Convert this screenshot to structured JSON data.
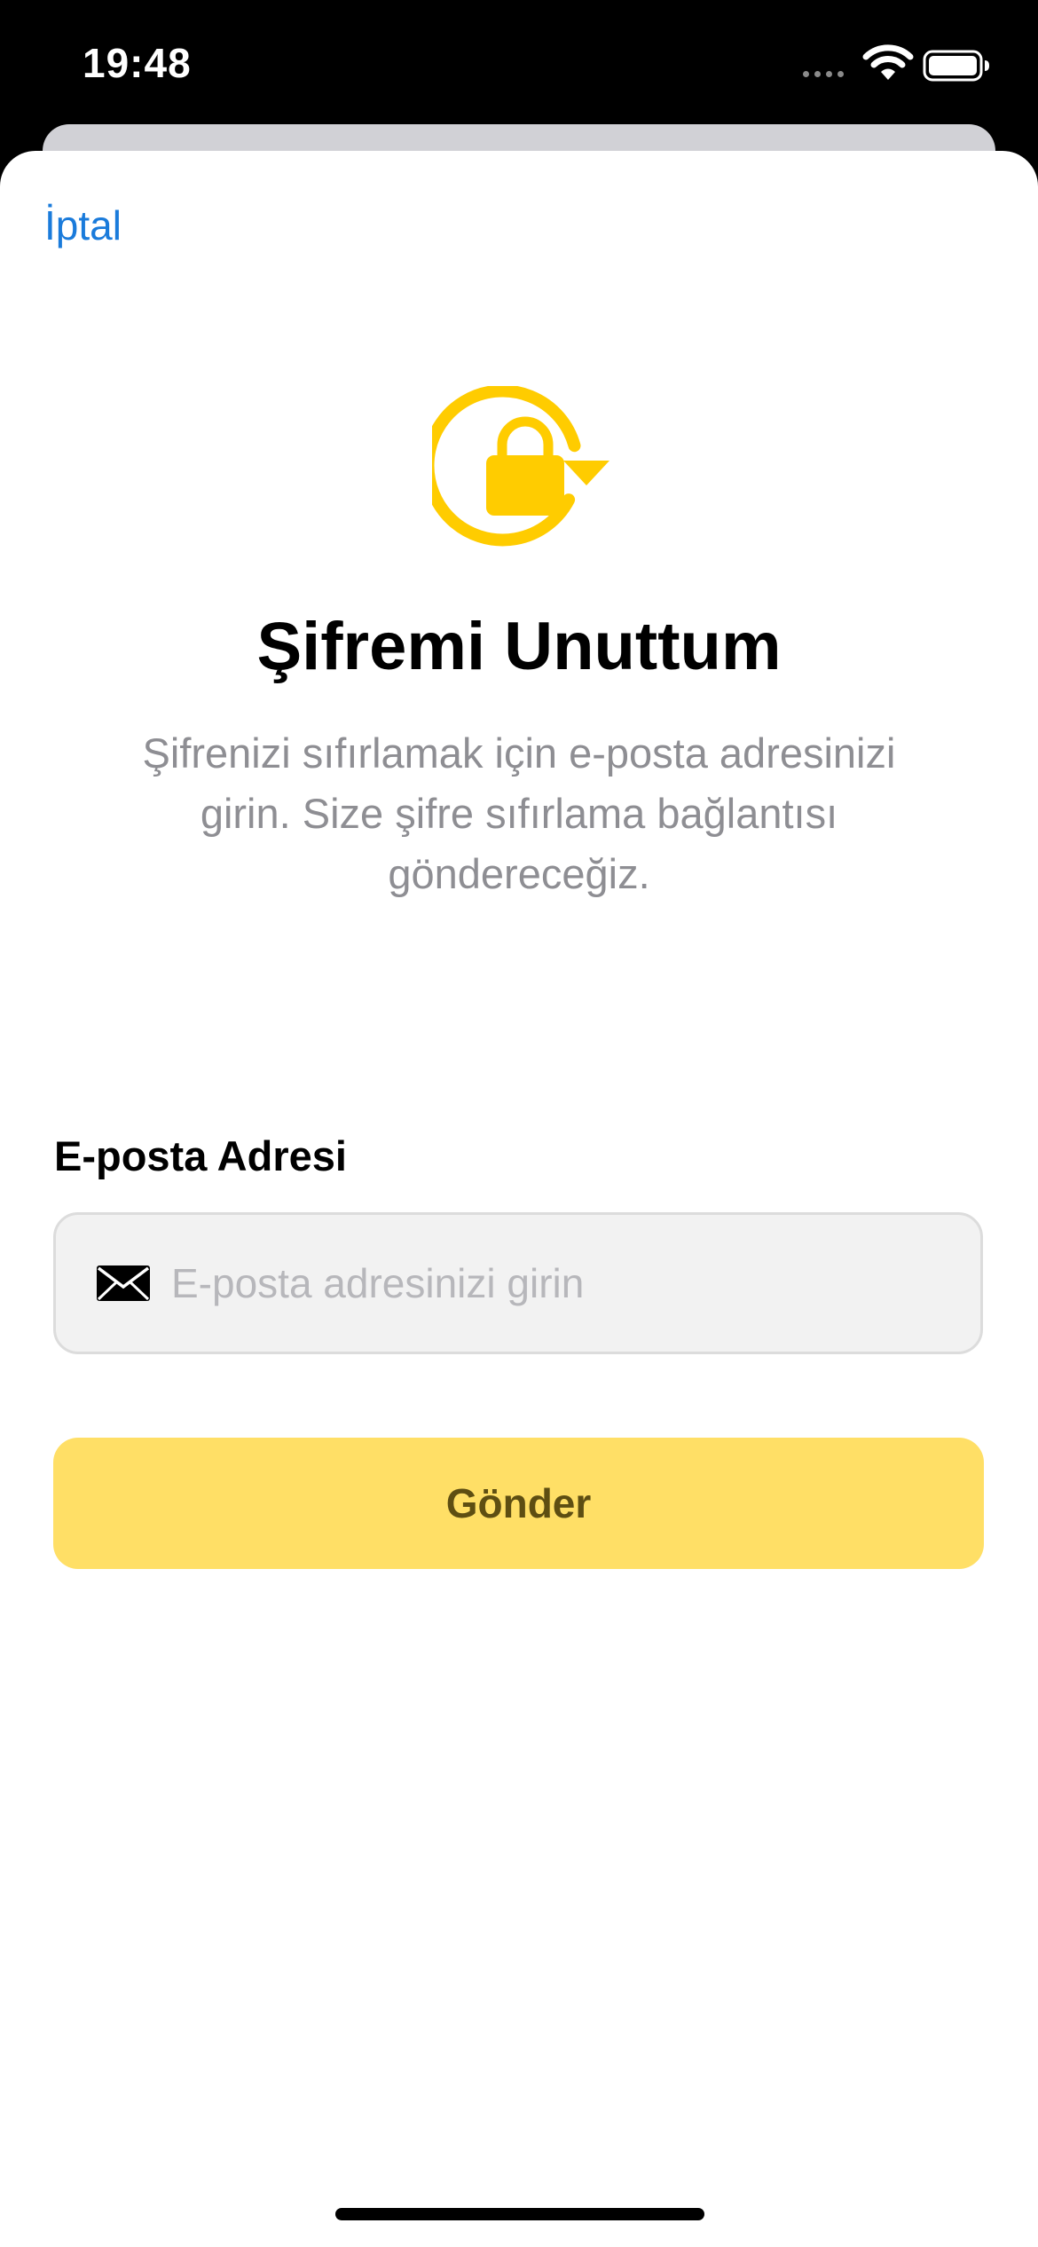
{
  "status_bar": {
    "time": "19:48"
  },
  "sheet": {
    "cancel_label": "İptal",
    "title": "Şifremi Unuttum",
    "description": "Şifrenizi sıfırlamak için e-posta adresinizi girin. Size şifre sıfırlama bağlantısı göndereceğiz.",
    "email_label": "E-posta Adresi",
    "email_placeholder": "E-posta adresinizi girin",
    "email_value": "",
    "send_label": "Gönder"
  },
  "icons": {
    "header": "lock-reset-icon",
    "field": "envelope-icon"
  },
  "colors": {
    "accent": "#FFCC00",
    "button_bg": "#FFDF66",
    "button_text": "#5E4E12",
    "link": "#1A7BDB",
    "secondary_text": "#8E8E93"
  }
}
